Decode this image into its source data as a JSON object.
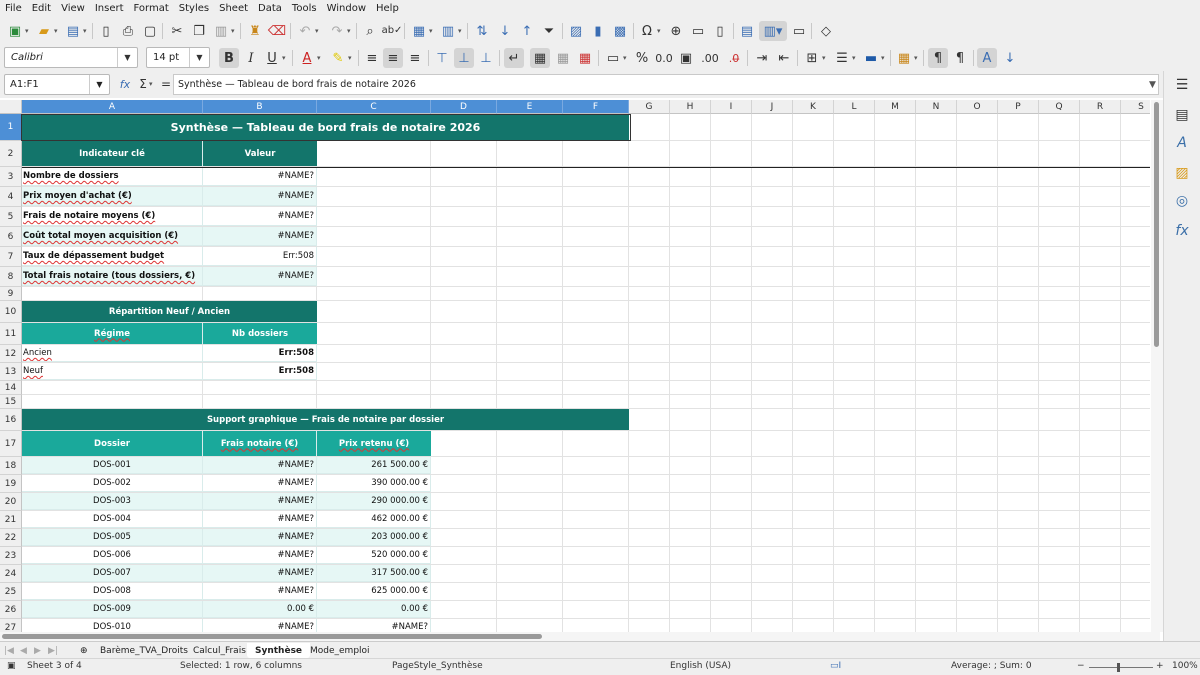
{
  "menu": [
    "File",
    "Edit",
    "View",
    "Insert",
    "Format",
    "Styles",
    "Sheet",
    "Data",
    "Tools",
    "Window",
    "Help"
  ],
  "font_name": "Calibri",
  "font_size": "14 pt",
  "name_box": "A1:F1",
  "formula_content": "Synthèse — Tableau de bord frais de notaire 2026",
  "columns": [
    "A",
    "B",
    "C",
    "D",
    "E",
    "F",
    "G",
    "H",
    "I",
    "J",
    "K",
    "L",
    "M",
    "N",
    "O",
    "P",
    "Q",
    "R",
    "S"
  ],
  "rows": [
    "1",
    "2",
    "3",
    "4",
    "5",
    "6",
    "7",
    "8",
    "9",
    "10",
    "11",
    "12",
    "13",
    "14",
    "15",
    "16",
    "17",
    "18",
    "19",
    "20",
    "21",
    "22",
    "23",
    "24",
    "25",
    "26",
    "27"
  ],
  "sheet": {
    "title": "Synthèse — Tableau de bord frais de notaire 2026",
    "kpi_header": {
      "indicator": "Indicateur clé",
      "value": "Valeur"
    },
    "kpis": [
      {
        "label": "Nombre de dossiers",
        "value": "#NAME?"
      },
      {
        "label": "Prix moyen d'achat (€)",
        "value": "#NAME?"
      },
      {
        "label": "Frais de notaire moyens (€)",
        "value": "#NAME?"
      },
      {
        "label": "Coût total moyen acquisition (€)",
        "value": "#NAME?"
      },
      {
        "label": "Taux de dépassement budget",
        "value": "Err:508"
      },
      {
        "label": "Total frais notaire (tous dossiers, €)",
        "value": "#NAME?"
      }
    ],
    "split_title": "Répartition Neuf / Ancien",
    "split_header": {
      "regime": "Régime",
      "count": "Nb dossiers"
    },
    "split_rows": [
      {
        "regime": "Ancien",
        "count": "Err:508"
      },
      {
        "regime": "Neuf",
        "count": "Err:508"
      }
    ],
    "chart_support_title": "Support graphique — Frais de notaire par dossier",
    "chart_support_header": {
      "dossier": "Dossier",
      "frais": "Frais notaire (€)",
      "prix": "Prix retenu (€)"
    },
    "chart_support_rows": [
      {
        "dossier": "DOS-001",
        "frais": "#NAME?",
        "prix": "261 500.00 €"
      },
      {
        "dossier": "DOS-002",
        "frais": "#NAME?",
        "prix": "390 000.00 €"
      },
      {
        "dossier": "DOS-003",
        "frais": "#NAME?",
        "prix": "290 000.00 €"
      },
      {
        "dossier": "DOS-004",
        "frais": "#NAME?",
        "prix": "462 000.00 €"
      },
      {
        "dossier": "DOS-005",
        "frais": "#NAME?",
        "prix": "203 000.00 €"
      },
      {
        "dossier": "DOS-006",
        "frais": "#NAME?",
        "prix": "520 000.00 €"
      },
      {
        "dossier": "DOS-007",
        "frais": "#NAME?",
        "prix": "317 500.00 €"
      },
      {
        "dossier": "DOS-008",
        "frais": "#NAME?",
        "prix": "625 000.00 €"
      },
      {
        "dossier": "DOS-009",
        "frais": "0.00 €",
        "prix": "0.00 €"
      },
      {
        "dossier": "DOS-010",
        "frais": "#NAME?",
        "prix": "#NAME?"
      }
    ]
  },
  "tabs": [
    "Barème_TVA_Droits",
    "Calcul_Frais",
    "Synthèse",
    "Mode_emploi"
  ],
  "active_tab": "Synthèse",
  "status": {
    "sheet": "Sheet 3 of 4",
    "selection": "Selected: 1 row, 6 columns",
    "page_style": "PageStyle_Synthèse",
    "language": "English (USA)",
    "summary": "Average: ; Sum: 0",
    "zoom": "100%"
  },
  "icons": {
    "accent": "#4d8fd6",
    "header_dark": "#13756b",
    "header_mid": "#1aa99b",
    "row_light": "#e6f7f5"
  }
}
